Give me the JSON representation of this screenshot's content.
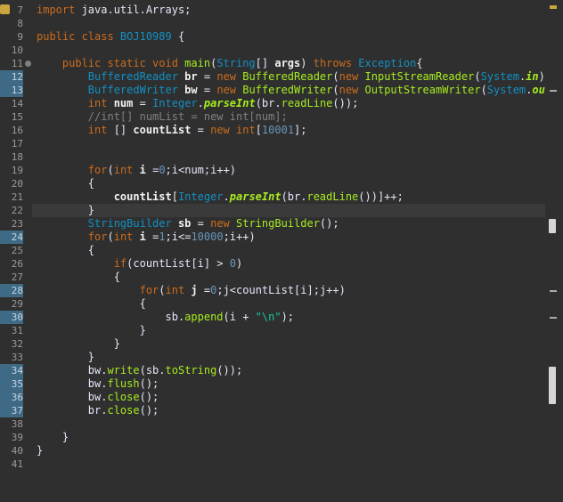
{
  "editor": {
    "lines": [
      {
        "n": "7",
        "tokens": [
          {
            "c": "kw",
            "t": "import "
          },
          {
            "c": "plain",
            "t": "java.util.Arrays;"
          }
        ]
      },
      {
        "n": "8",
        "tokens": []
      },
      {
        "n": "9",
        "tokens": [
          {
            "c": "kw",
            "t": "public class "
          },
          {
            "c": "typ",
            "t": "BOJ10989"
          },
          {
            "c": "plain",
            "t": " {"
          }
        ]
      },
      {
        "n": "10",
        "tokens": []
      },
      {
        "n": "11",
        "tokens": [
          {
            "c": "kw",
            "t": "    public static void "
          },
          {
            "c": "call",
            "t": "main"
          },
          {
            "c": "plain",
            "t": "("
          },
          {
            "c": "typ",
            "t": "String"
          },
          {
            "c": "plain",
            "t": "[] "
          },
          {
            "c": "var",
            "t": "args"
          },
          {
            "c": "plain",
            "t": ") "
          },
          {
            "c": "kw",
            "t": "throws "
          },
          {
            "c": "typ",
            "t": "Exception"
          },
          {
            "c": "plain",
            "t": "{"
          }
        ]
      },
      {
        "n": "12",
        "tokens": [
          {
            "c": "typ",
            "t": "        BufferedReader "
          },
          {
            "c": "var",
            "t": "br"
          },
          {
            "c": "plain",
            "t": " = "
          },
          {
            "c": "kw",
            "t": "new "
          },
          {
            "c": "call",
            "t": "BufferedReader"
          },
          {
            "c": "plain",
            "t": "("
          },
          {
            "c": "kw",
            "t": "new "
          },
          {
            "c": "call",
            "t": "InputStreamReader"
          },
          {
            "c": "plain",
            "t": "("
          },
          {
            "c": "typ",
            "t": "System"
          },
          {
            "c": "plain",
            "t": "."
          },
          {
            "c": "it",
            "t": "in"
          },
          {
            "c": "plain",
            "t": ")"
          }
        ]
      },
      {
        "n": "13",
        "tokens": [
          {
            "c": "typ",
            "t": "        BufferedWriter "
          },
          {
            "c": "var",
            "t": "bw"
          },
          {
            "c": "plain",
            "t": " = "
          },
          {
            "c": "kw",
            "t": "new "
          },
          {
            "c": "call",
            "t": "BufferedWriter"
          },
          {
            "c": "plain",
            "t": "("
          },
          {
            "c": "kw",
            "t": "new "
          },
          {
            "c": "call",
            "t": "OutputStreamWriter"
          },
          {
            "c": "plain",
            "t": "("
          },
          {
            "c": "typ",
            "t": "System"
          },
          {
            "c": "plain",
            "t": "."
          },
          {
            "c": "it",
            "t": "ou"
          }
        ]
      },
      {
        "n": "14",
        "tokens": [
          {
            "c": "kw",
            "t": "        int "
          },
          {
            "c": "var",
            "t": "num"
          },
          {
            "c": "plain",
            "t": " = "
          },
          {
            "c": "typ",
            "t": "Integer"
          },
          {
            "c": "plain",
            "t": "."
          },
          {
            "c": "it",
            "t": "parseInt"
          },
          {
            "c": "plain",
            "t": "(br."
          },
          {
            "c": "call",
            "t": "readLine"
          },
          {
            "c": "plain",
            "t": "());"
          }
        ]
      },
      {
        "n": "15",
        "tokens": [
          {
            "c": "cm",
            "t": "        //int[] numList = new int[num];"
          }
        ]
      },
      {
        "n": "16",
        "tokens": [
          {
            "c": "kw",
            "t": "        int "
          },
          {
            "c": "plain",
            "t": "[] "
          },
          {
            "c": "var",
            "t": "countList"
          },
          {
            "c": "plain",
            "t": " = "
          },
          {
            "c": "kw",
            "t": "new int"
          },
          {
            "c": "plain",
            "t": "["
          },
          {
            "c": "num-lit",
            "t": "10001"
          },
          {
            "c": "plain",
            "t": "];"
          }
        ]
      },
      {
        "n": "17",
        "tokens": []
      },
      {
        "n": "18",
        "tokens": []
      },
      {
        "n": "19",
        "tokens": [
          {
            "c": "kw",
            "t": "        for"
          },
          {
            "c": "plain",
            "t": "("
          },
          {
            "c": "kw",
            "t": "int "
          },
          {
            "c": "var",
            "t": "i"
          },
          {
            "c": "plain",
            "t": " ="
          },
          {
            "c": "num-lit",
            "t": "0"
          },
          {
            "c": "plain",
            "t": ";i<num;i++)"
          }
        ]
      },
      {
        "n": "20",
        "tokens": [
          {
            "c": "plain",
            "t": "        {"
          }
        ]
      },
      {
        "n": "21",
        "tokens": [
          {
            "c": "var",
            "t": "            countList"
          },
          {
            "c": "plain",
            "t": "["
          },
          {
            "c": "typ",
            "t": "Integer"
          },
          {
            "c": "plain",
            "t": "."
          },
          {
            "c": "it",
            "t": "parseInt"
          },
          {
            "c": "plain",
            "t": "(br."
          },
          {
            "c": "call",
            "t": "readLine"
          },
          {
            "c": "plain",
            "t": "())]++;"
          }
        ]
      },
      {
        "n": "22",
        "tokens": [
          {
            "c": "plain",
            "t": "        }"
          }
        ]
      },
      {
        "n": "23",
        "tokens": [
          {
            "c": "typ",
            "t": "        StringBuilder "
          },
          {
            "c": "var",
            "t": "sb"
          },
          {
            "c": "plain",
            "t": " = "
          },
          {
            "c": "kw",
            "t": "new "
          },
          {
            "c": "call",
            "t": "StringBuilder"
          },
          {
            "c": "plain",
            "t": "();"
          }
        ]
      },
      {
        "n": "24",
        "tokens": [
          {
            "c": "kw",
            "t": "        for"
          },
          {
            "c": "plain",
            "t": "("
          },
          {
            "c": "kw",
            "t": "int "
          },
          {
            "c": "var",
            "t": "i"
          },
          {
            "c": "plain",
            "t": " ="
          },
          {
            "c": "num-lit",
            "t": "1"
          },
          {
            "c": "plain",
            "t": ";i<="
          },
          {
            "c": "num-lit",
            "t": "10000"
          },
          {
            "c": "plain",
            "t": ";i++)"
          }
        ]
      },
      {
        "n": "25",
        "tokens": [
          {
            "c": "plain",
            "t": "        {"
          }
        ]
      },
      {
        "n": "26",
        "tokens": [
          {
            "c": "kw",
            "t": "            if"
          },
          {
            "c": "plain",
            "t": "(countList[i] > "
          },
          {
            "c": "num-lit",
            "t": "0"
          },
          {
            "c": "plain",
            "t": ")"
          }
        ]
      },
      {
        "n": "27",
        "tokens": [
          {
            "c": "plain",
            "t": "            {"
          }
        ]
      },
      {
        "n": "28",
        "tokens": [
          {
            "c": "kw",
            "t": "                for"
          },
          {
            "c": "plain",
            "t": "("
          },
          {
            "c": "kw",
            "t": "int "
          },
          {
            "c": "var",
            "t": "j"
          },
          {
            "c": "plain",
            "t": " ="
          },
          {
            "c": "num-lit",
            "t": "0"
          },
          {
            "c": "plain",
            "t": ";j<countList[i];j++)"
          }
        ]
      },
      {
        "n": "29",
        "tokens": [
          {
            "c": "plain",
            "t": "                {"
          }
        ]
      },
      {
        "n": "30",
        "tokens": [
          {
            "c": "plain",
            "t": "                    sb."
          },
          {
            "c": "call",
            "t": "append"
          },
          {
            "c": "plain",
            "t": "(i + "
          },
          {
            "c": "str",
            "t": "\"\\n\""
          },
          {
            "c": "plain",
            "t": ");"
          }
        ]
      },
      {
        "n": "31",
        "tokens": [
          {
            "c": "plain",
            "t": "                }"
          }
        ]
      },
      {
        "n": "32",
        "tokens": [
          {
            "c": "plain",
            "t": "            }"
          }
        ]
      },
      {
        "n": "33",
        "tokens": [
          {
            "c": "plain",
            "t": "        }"
          }
        ]
      },
      {
        "n": "34",
        "tokens": [
          {
            "c": "plain",
            "t": "        bw."
          },
          {
            "c": "call",
            "t": "write"
          },
          {
            "c": "plain",
            "t": "(sb."
          },
          {
            "c": "call",
            "t": "toString"
          },
          {
            "c": "plain",
            "t": "());"
          }
        ]
      },
      {
        "n": "35",
        "tokens": [
          {
            "c": "plain",
            "t": "        bw."
          },
          {
            "c": "call",
            "t": "flush"
          },
          {
            "c": "plain",
            "t": "();"
          }
        ]
      },
      {
        "n": "36",
        "tokens": [
          {
            "c": "plain",
            "t": "        bw."
          },
          {
            "c": "call",
            "t": "close"
          },
          {
            "c": "plain",
            "t": "();"
          }
        ]
      },
      {
        "n": "37",
        "tokens": [
          {
            "c": "plain",
            "t": "        br."
          },
          {
            "c": "call",
            "t": "close"
          },
          {
            "c": "plain",
            "t": "();"
          }
        ]
      },
      {
        "n": "38",
        "tokens": []
      },
      {
        "n": "39",
        "tokens": [
          {
            "c": "plain",
            "t": "    }"
          }
        ]
      },
      {
        "n": "40",
        "tokens": [
          {
            "c": "plain",
            "t": "}"
          }
        ]
      },
      {
        "n": "41",
        "tokens": []
      }
    ],
    "highlighted_numbers": [
      "12",
      "13",
      "24",
      "28",
      "30",
      "34",
      "35",
      "36",
      "37"
    ],
    "folded_marker_line": "11",
    "current_line": "22",
    "colors": {
      "background": "#2f2f2f",
      "keyword": "#cc6c1d",
      "type": "#1290c3",
      "method": "#a7ec21",
      "string": "#17c6a3",
      "number": "#6897bb",
      "comment": "#808080"
    }
  }
}
